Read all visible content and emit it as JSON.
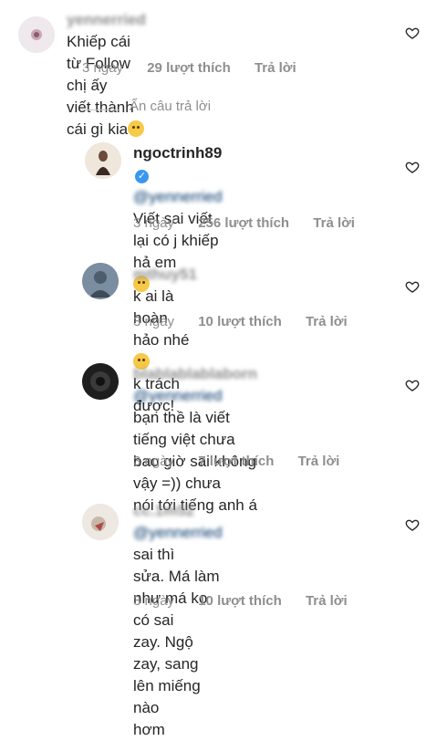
{
  "comments": [
    {
      "user": "yennerried",
      "mention": "",
      "lines": [
        "Khiếp cái từ Follow chị ấy",
        "viết thành cái gì kia"
      ],
      "time": "3 ngày",
      "likes": "29 lượt thích",
      "reply": "Trả lời"
    },
    {
      "user": "ngoctrinh89",
      "mention": "@yennerried",
      "lines": [
        "Viết sai viết lại có j khiếp hả em",
        ""
      ],
      "time": "3 ngày",
      "likes": "256 lượt thích",
      "reply": "Trả lời"
    },
    {
      "user": "mthuy51",
      "mention": "",
      "lines": [
        "k ai là hoàn hảo nhé",
        "k trách được!"
      ],
      "time": "3 ngày",
      "likes": "10 lượt thích",
      "reply": "Trả lời"
    },
    {
      "user": "blablablablaborn",
      "mention": "@yennerried",
      "lines": [
        "bạn thề là viết tiếng việt chưa",
        "bao giờ sai không vậy =)) chưa",
        "nói tới tiếng anh á"
      ],
      "time": "3 ngày",
      "likes": "7 lượt thích",
      "reply": "Trả lời"
    },
    {
      "user": "cc.1m52",
      "mention": "@yennerried",
      "lines": [
        "sai thì",
        "sửa. Má làm như má ko có sai",
        "zay. Ngộ zay, sang lên miếng nào",
        "hơm"
      ],
      "time": "3 ngày",
      "likes": "10 lượt thích",
      "reply": "Trả lời"
    }
  ],
  "hide_replies": "Ẩn câu trả lời",
  "colors": {
    "verified": "#3897f0",
    "meta": "#8e8e8e",
    "text": "#262626"
  },
  "icons": {
    "like": "heart-outline-icon",
    "verified": "verified-badge-icon"
  }
}
